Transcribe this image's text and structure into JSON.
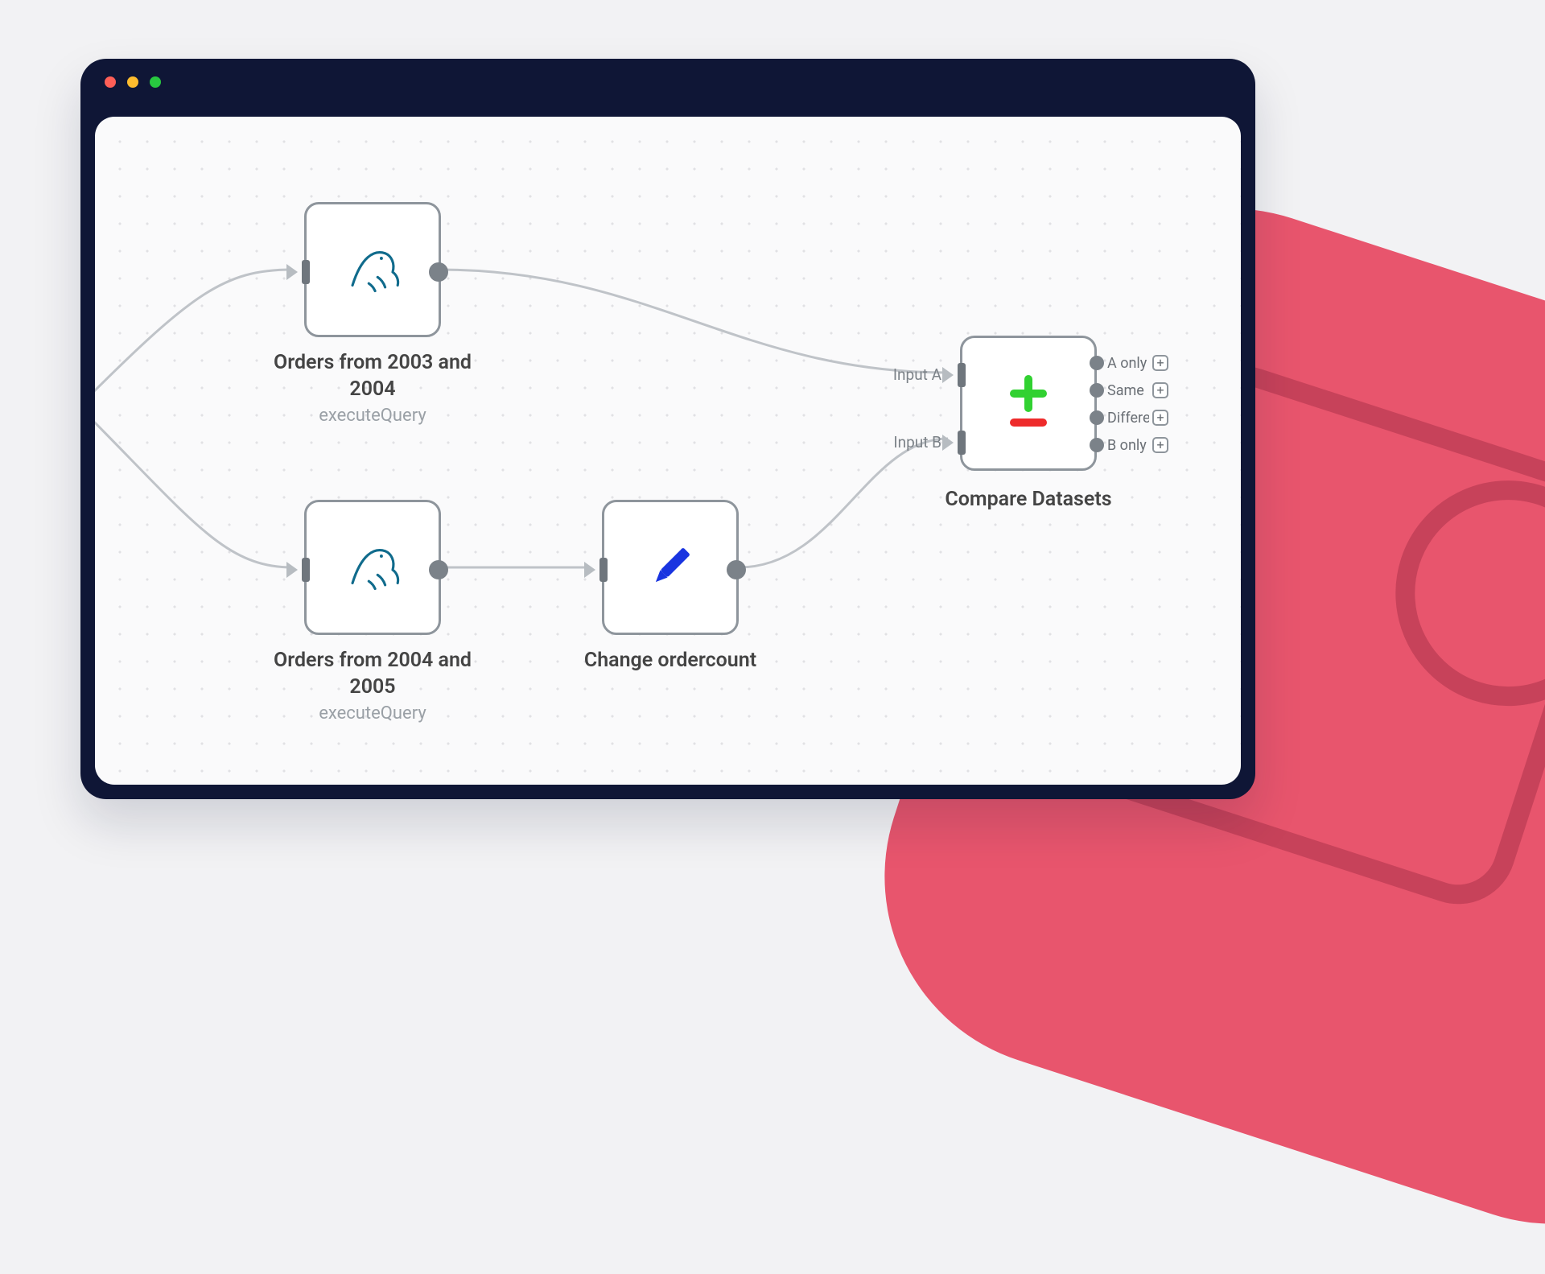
{
  "window": {
    "traffic_light_colors": {
      "close": "#ff5f57",
      "min": "#febc2e",
      "max": "#28c840"
    }
  },
  "nodes": {
    "orders_2003_2004": {
      "title": "Orders from 2003 and 2004",
      "subtitle": "executeQuery"
    },
    "orders_2004_2005": {
      "title": "Orders from 2004 and 2005",
      "subtitle": "executeQuery"
    },
    "change_ordercount": {
      "title": "Change ordercount"
    },
    "compare": {
      "title": "Compare Datasets",
      "inputs": {
        "a": "Input A",
        "b": "Input B"
      },
      "outputs": [
        "A only",
        "Same",
        "Different",
        "B only"
      ]
    }
  },
  "colors": {
    "node_border": "#8e959c",
    "wire": "#bfc3c8",
    "plus_icon": "#31d131",
    "minus_icon": "#ee2b2b",
    "pencil_icon": "#1934e0",
    "mysql_icon": "#0f6b8c"
  }
}
